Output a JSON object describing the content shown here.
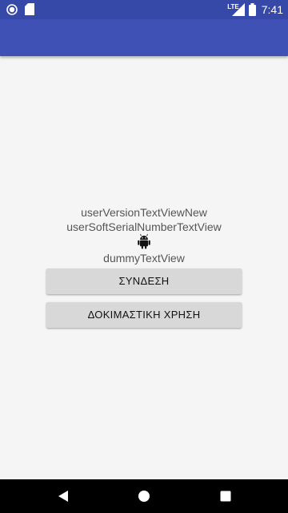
{
  "status_bar": {
    "time": "7:41",
    "network_label": "LTE",
    "icons": [
      "app-notification-icon",
      "sd-card-icon",
      "lte-signal-icon",
      "battery-icon"
    ]
  },
  "main": {
    "version_text": "userVersionTextViewNew",
    "serial_text": "userSoftSerialNumberTextView",
    "logo_icon": "android-icon",
    "dummy_text": "dummyTextView",
    "login_button": "ΣΥΝΔΕΣΗ",
    "trial_button": "ΔΟΚΙΜΑΣΤΙΚΗ ΧΡΗΣΗ"
  },
  "nav_bar": {
    "icons": [
      "back-icon",
      "home-icon",
      "recents-icon"
    ]
  },
  "colors": {
    "primary": "#3f51b5",
    "primary_dark": "#3749a8",
    "background": "#f5f5f5",
    "button": "#d8d8d8"
  }
}
